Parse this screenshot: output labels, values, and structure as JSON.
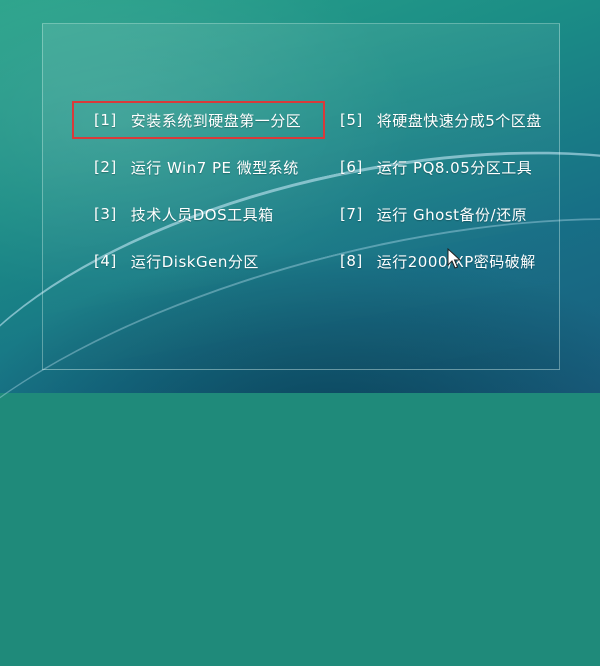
{
  "menu": {
    "items": [
      {
        "num": "[1]",
        "label": "安装系统到硬盘第一分区",
        "selected": true
      },
      {
        "num": "[5]",
        "label": "将硬盘快速分成5个区盘"
      },
      {
        "num": "[2]",
        "label": "运行 Win7 PE 微型系统"
      },
      {
        "num": "[6]",
        "label": "运行 PQ8.05分区工具"
      },
      {
        "num": "[3]",
        "label": "技术人员DOS工具箱"
      },
      {
        "num": "[7]",
        "label": "运行 Ghost备份/还原"
      },
      {
        "num": "[4]",
        "label": "运行DiskGen分区"
      },
      {
        "num": "[8]",
        "label": "运行2000/XP密码破解"
      }
    ]
  },
  "colors": {
    "selection_border": "#d93a3a",
    "text": "#ffffff"
  },
  "icons": {
    "cursor": "mouse-pointer-icon"
  }
}
